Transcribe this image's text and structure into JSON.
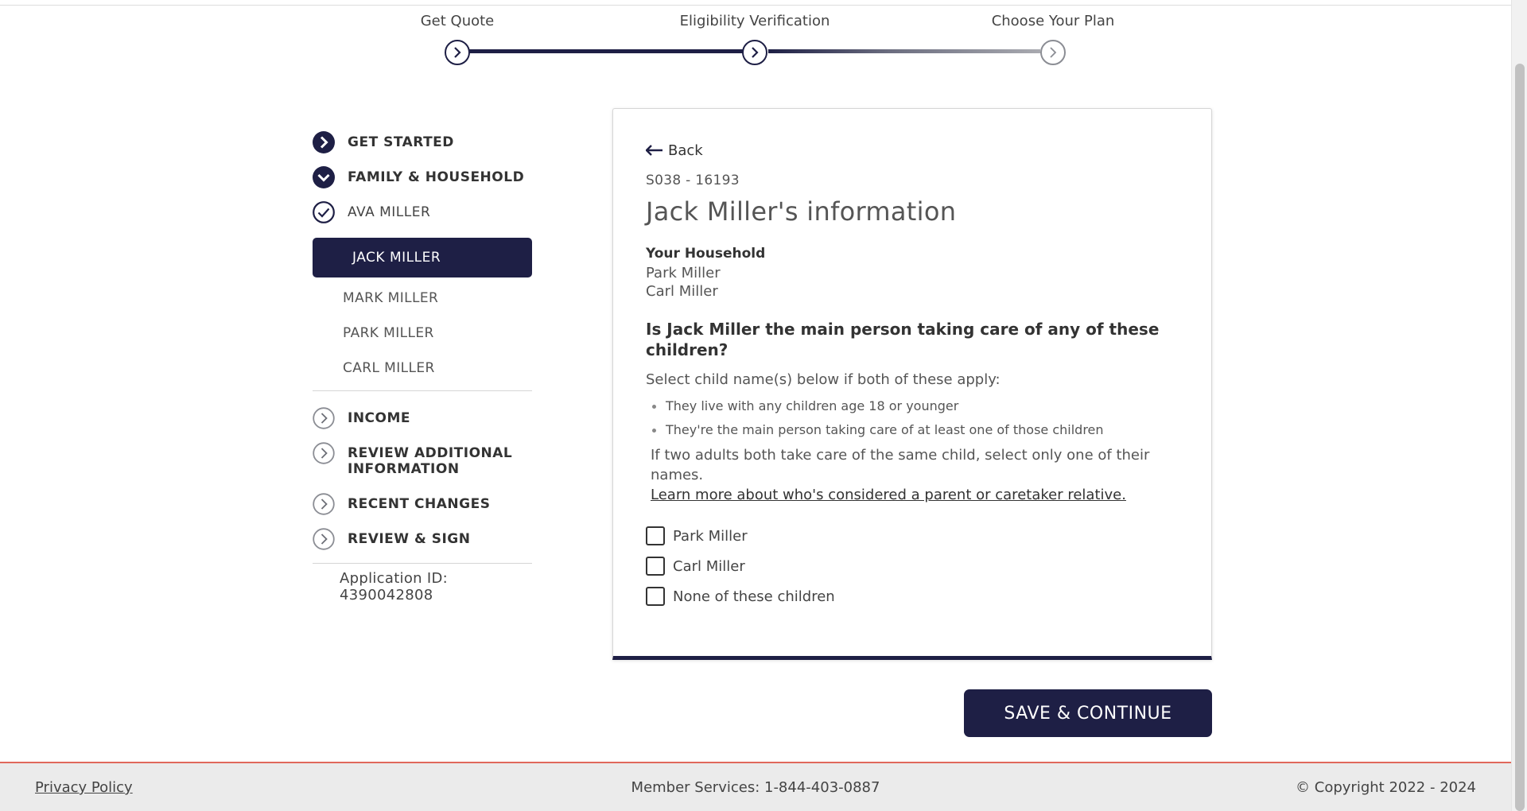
{
  "stepper": {
    "steps": [
      {
        "label": "Get Quote",
        "state": "complete"
      },
      {
        "label": "Eligibility Verification",
        "state": "current"
      },
      {
        "label": "Choose Your Plan",
        "state": "upcoming"
      }
    ]
  },
  "sidebar": {
    "sections_top": [
      {
        "label": "GET STARTED",
        "icon": "chevron-right-circle-filled-icon"
      },
      {
        "label": "FAMILY & HOUSEHOLD",
        "icon": "chevron-down-circle-filled-icon"
      }
    ],
    "completed_member": {
      "label": "AVA MILLER",
      "icon": "check-circle-icon"
    },
    "active_member": "JACK MILLER",
    "members": [
      "MARK MILLER",
      "PARK MILLER",
      "CARL MILLER"
    ],
    "sections_bottom": [
      {
        "label": "INCOME",
        "icon": "chevron-right-circle-outline-icon"
      },
      {
        "label": "REVIEW ADDITIONAL INFORMATION",
        "icon": "chevron-right-circle-outline-icon"
      },
      {
        "label": "RECENT CHANGES",
        "icon": "chevron-right-circle-outline-icon"
      },
      {
        "label": "REVIEW & SIGN",
        "icon": "chevron-right-circle-outline-icon"
      }
    ],
    "application_id": "Application ID: 4390042808"
  },
  "card": {
    "back_label": "Back",
    "case_id": "S038 - 16193",
    "title": "Jack Miller's information",
    "household_title": "Your Household",
    "household_members": [
      "Park Miller",
      "Carl Miller"
    ],
    "question": "Is Jack Miller the main person taking care of any of these children?",
    "instruction": "Select child name(s) below if both of these apply:",
    "bullets": [
      "They live with any children age 18 or younger",
      "They're the main person taking care of at least one of those children"
    ],
    "note": "If two adults both take care of the same child, select only one of their names.",
    "learn_more": "Learn more about who's considered a parent or caretaker relative.",
    "options": [
      "Park Miller",
      "Carl Miller",
      "None of these children"
    ]
  },
  "save_button": "SAVE & CONTINUE",
  "footer": {
    "privacy": "Privacy Policy",
    "services": "Member Services: 1-844-403-0887",
    "copyright": "© Copyright 2022 - 2024"
  },
  "colors": {
    "brand_navy": "#1e1f45",
    "footer_accent": "#e0685b",
    "footer_bg": "#ebebeb"
  }
}
